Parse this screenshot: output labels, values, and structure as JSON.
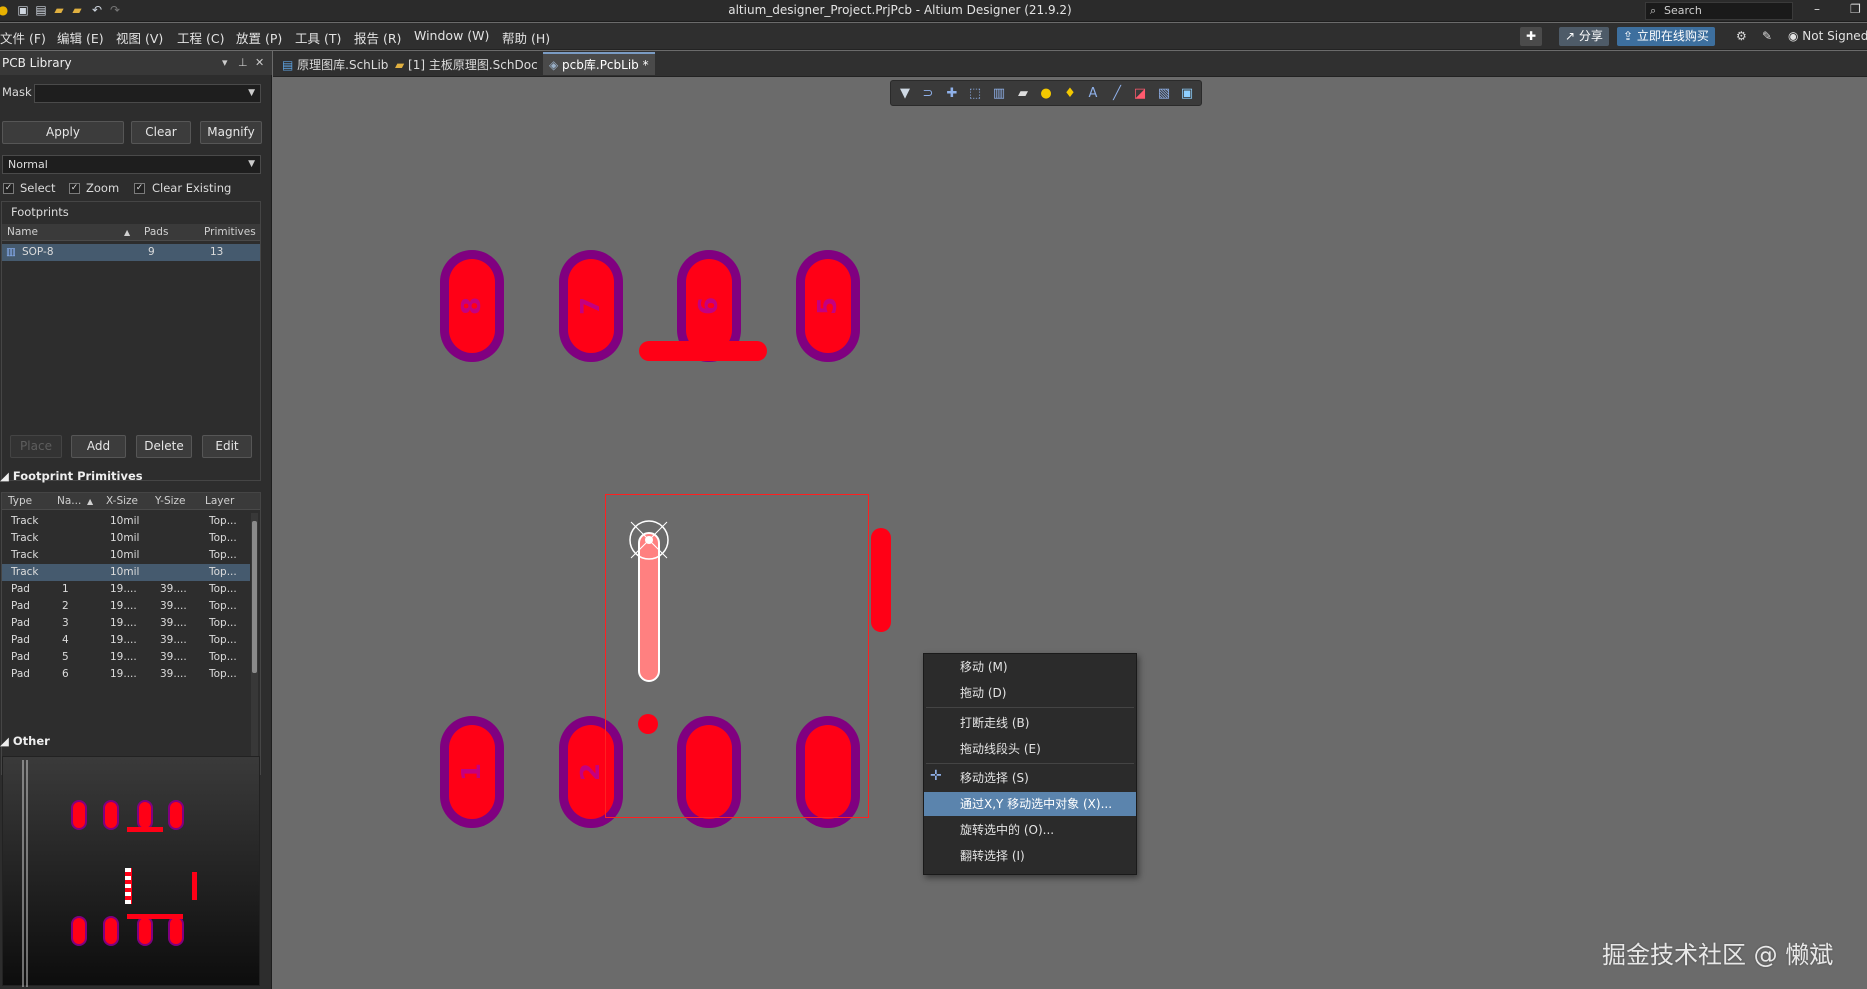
{
  "window": {
    "title": "altium_designer_Project.PrjPcb - Altium Designer (21.9.2)",
    "search_placeholder": "Search"
  },
  "menubar": {
    "items": [
      "文件 (F)",
      "编辑 (E)",
      "视图 (V)",
      "工程 (C)",
      "放置 (P)",
      "工具 (T)",
      "报告 (R)",
      "Window (W)",
      "帮助 (H)"
    ],
    "share_label": "分享",
    "buy_label": "立即在线购买",
    "user_label": "Not Signed"
  },
  "panel": {
    "title": "PCB Library",
    "mask_label": "Mask",
    "mask_value": "",
    "apply_label": "Apply",
    "clear_label": "Clear",
    "magnify_label": "Magnify",
    "mode_value": "Normal",
    "select_label": "Select",
    "zoom_label": "Zoom",
    "clear_existing_label": "Clear Existing",
    "footprints_group": "Footprints",
    "fp_headers": [
      "Name",
      "Pads",
      "Primitives"
    ],
    "footprints": [
      {
        "name": "SOP-8",
        "pads": "9",
        "primitives": "13"
      }
    ],
    "place_label": "Place",
    "add_label": "Add",
    "delete_label": "Delete",
    "edit_label": "Edit",
    "primitives_title": "Footprint Primitives",
    "prim_headers": [
      "Type",
      "Na...",
      "X-Size",
      "Y-Size",
      "Layer"
    ],
    "primitives": [
      {
        "type": "Track",
        "name": "",
        "x": "10mil",
        "y": "",
        "layer": "Top..."
      },
      {
        "type": "Track",
        "name": "",
        "x": "10mil",
        "y": "",
        "layer": "Top..."
      },
      {
        "type": "Track",
        "name": "",
        "x": "10mil",
        "y": "",
        "layer": "Top..."
      },
      {
        "type": "Track",
        "name": "",
        "x": "10mil",
        "y": "",
        "layer": "Top..."
      },
      {
        "type": "Pad",
        "name": "1",
        "x": "19....",
        "y": "39....",
        "layer": "Top..."
      },
      {
        "type": "Pad",
        "name": "2",
        "x": "19....",
        "y": "39....",
        "layer": "Top..."
      },
      {
        "type": "Pad",
        "name": "3",
        "x": "19....",
        "y": "39....",
        "layer": "Top..."
      },
      {
        "type": "Pad",
        "name": "4",
        "x": "19....",
        "y": "39....",
        "layer": "Top..."
      },
      {
        "type": "Pad",
        "name": "5",
        "x": "19....",
        "y": "39....",
        "layer": "Top..."
      },
      {
        "type": "Pad",
        "name": "6",
        "x": "19....",
        "y": "39....",
        "layer": "Top..."
      }
    ],
    "other_title": "Other"
  },
  "tabs": [
    "原理图库.SchLib",
    "[1] 主板原理图.SchDoc",
    "pcb库.PcbLib *"
  ],
  "pads": [
    "8",
    "7",
    "6",
    "5",
    "1",
    "2"
  ],
  "context_menu": [
    {
      "label": "移动 (M)"
    },
    {
      "label": "拖动 (D)"
    },
    {
      "label": "打断走线 (B)"
    },
    {
      "label": "拖动线段头 (E)"
    },
    {
      "label": "移动选择 (S)"
    },
    {
      "label": "通过X,Y 移动选中对象 (X)..."
    },
    {
      "label": "旋转选中的 (O)..."
    },
    {
      "label": "翻转选择 (I)"
    }
  ],
  "watermark": "掘金技术社区 @ 懒斌",
  "colors": {
    "pad_copper": "#ff0016",
    "pad_ring": "#800080",
    "selection": "#5b84ad",
    "canvas": "#6b6b6b"
  }
}
